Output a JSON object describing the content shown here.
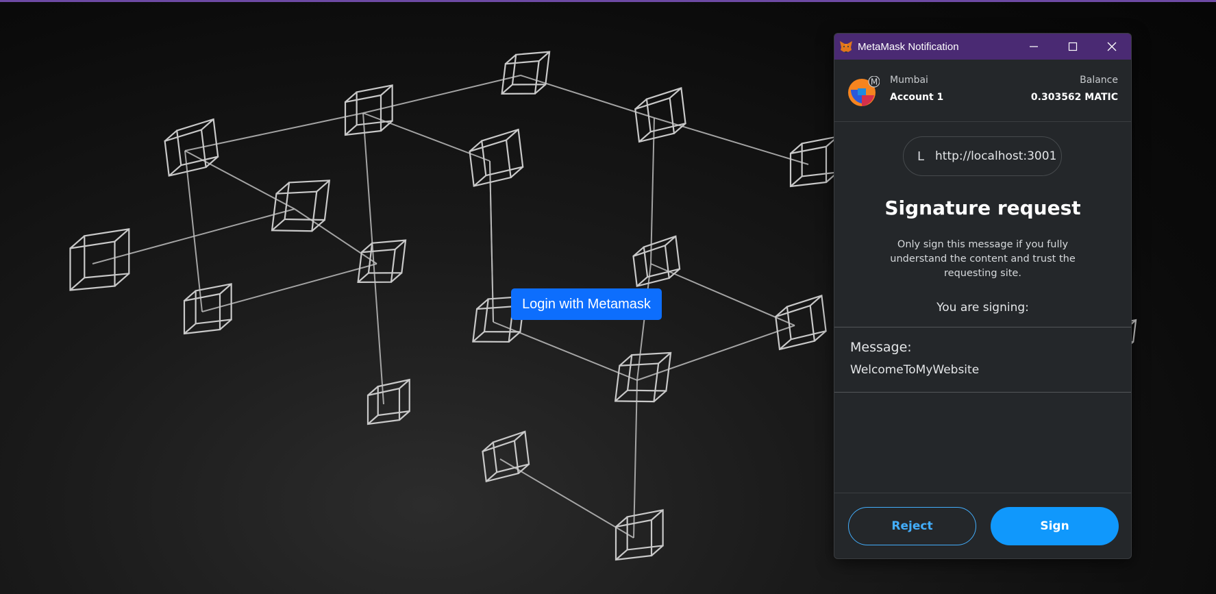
{
  "background": {
    "login_button": "Login with Metamask"
  },
  "popup": {
    "title": "MetaMask Notification",
    "window_controls": {
      "minimize_icon": "minimize-icon",
      "maximize_icon": "maximize-icon",
      "close_icon": "close-icon"
    },
    "account": {
      "network": "Mumbai",
      "network_badge": "M",
      "name": "Account 1",
      "balance_label": "Balance",
      "balance_value": "0.303562 MATIC"
    },
    "origin": {
      "icon_letter": "L",
      "url": "http://localhost:3001"
    },
    "title_heading": "Signature request",
    "description": "Only sign this message if you fully understand the content and trust the requesting site.",
    "signing_label": "You are signing:",
    "message": {
      "label": "Message:",
      "value": "WelcomeToMyWebsite"
    },
    "buttons": {
      "reject": "Reject",
      "sign": "Sign"
    }
  },
  "colors": {
    "titlebar": "#4a2a73",
    "panel_bg": "#24272a",
    "accent_blue": "#1098fc",
    "login_blue": "#0d6efd"
  }
}
